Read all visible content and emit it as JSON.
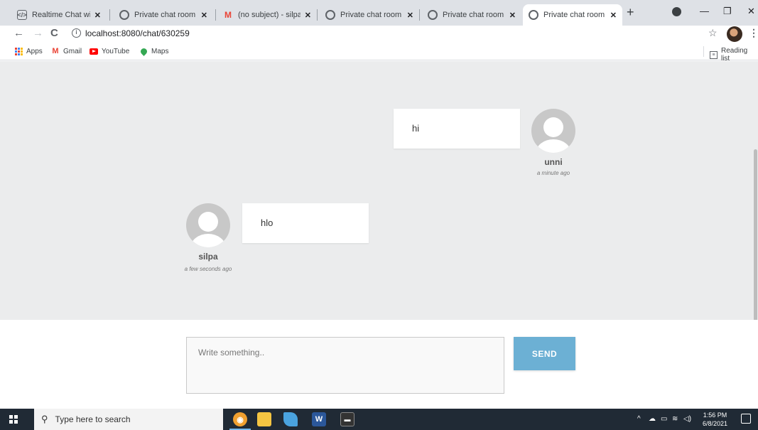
{
  "browser": {
    "tabs": [
      {
        "title": "Realtime Chat with No",
        "icon": "code-icon",
        "color": "#5f6368"
      },
      {
        "title": "Private chat room | Tu",
        "icon": "globe-icon",
        "color": "#5f6368"
      },
      {
        "title": "(no subject) - silpakris",
        "icon": "gmail-icon",
        "color": "#ea4335"
      },
      {
        "title": "Private chat room | Tu",
        "icon": "globe-icon",
        "color": "#5f6368"
      },
      {
        "title": "Private chat room | Tu",
        "icon": "globe-icon",
        "color": "#5f6368"
      },
      {
        "title": "Private chat room | Tu",
        "icon": "globe-icon",
        "color": "#5f6368",
        "active": true
      }
    ],
    "url": "localhost:8080/chat/630259",
    "bookmarks": [
      {
        "label": "Apps",
        "icon": "apps-grid-icon"
      },
      {
        "label": "Gmail",
        "icon": "gmail-icon"
      },
      {
        "label": "YouTube",
        "icon": "youtube-icon"
      },
      {
        "label": "Maps",
        "icon": "maps-pin-icon"
      }
    ],
    "reading_list": "Reading list"
  },
  "chat": {
    "messages": [
      {
        "text": "hi",
        "user": "unni",
        "time": "a minute ago",
        "side": "right"
      },
      {
        "text": "hlo",
        "user": "silpa",
        "time": "a few seconds ago",
        "side": "left"
      }
    ],
    "input_placeholder": "Write something..",
    "send_label": "SEND",
    "send_color": "#6cb0d4"
  },
  "taskbar": {
    "search_placeholder": "Type here to search",
    "apps": [
      {
        "icon": "chrome-icon",
        "color": "#f0a030"
      },
      {
        "icon": "file-explorer-icon",
        "color": "#f5c542"
      },
      {
        "icon": "edge-icon",
        "color": "#4aa3df"
      },
      {
        "icon": "word-icon",
        "color": "#2b579a"
      },
      {
        "icon": "terminal-icon",
        "color": "#333333"
      }
    ],
    "time": "1:56 PM",
    "date": "6/8/2021"
  }
}
